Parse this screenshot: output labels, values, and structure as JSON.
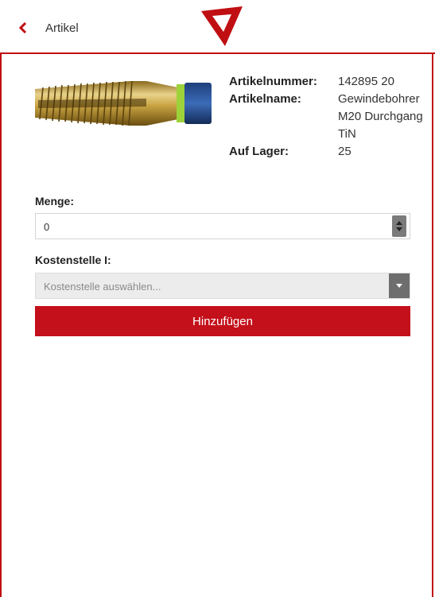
{
  "header": {
    "back_icon": "chevron-left-icon",
    "title": "Artikel",
    "logo_icon": "triangle-logo-icon",
    "accent_color": "#c00f12"
  },
  "product": {
    "image_icon": "tap-tool-image",
    "fields": [
      {
        "label": "Artikelnummer:",
        "value": "142895 20"
      },
      {
        "label": "Artikelname:",
        "value": "Gewindebohrer M20 Durchgang TiN"
      },
      {
        "label": "Auf Lager:",
        "value": "25"
      }
    ]
  },
  "form": {
    "quantity_label": "Menge:",
    "quantity_value": "0",
    "cost_center_label": "Kostenstelle I:",
    "cost_center_placeholder": "Kostenstelle auswählen...",
    "add_button": "Hinzufügen"
  }
}
